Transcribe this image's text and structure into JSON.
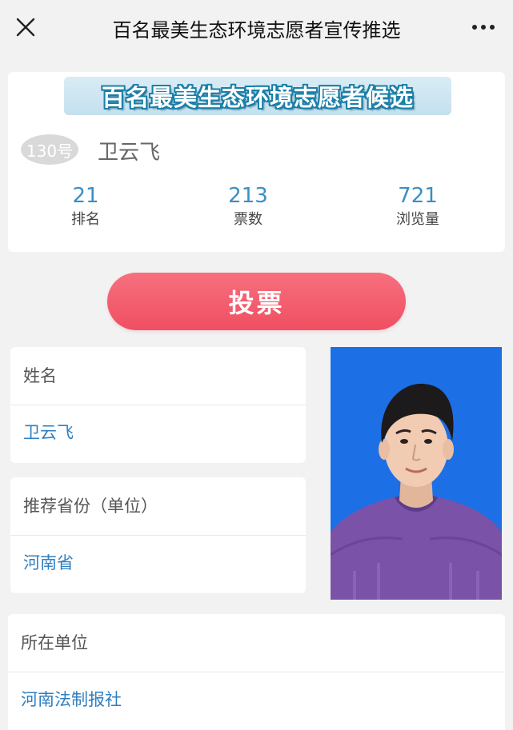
{
  "nav": {
    "title": "百名最美生态环境志愿者宣传推选"
  },
  "banner": {
    "title": "百名最美生态环境志愿者候选"
  },
  "candidate": {
    "number": "130号",
    "name": "卫云飞"
  },
  "stats": [
    {
      "value": "21",
      "label": "排名"
    },
    {
      "value": "213",
      "label": "票数"
    },
    {
      "value": "721",
      "label": "浏览量"
    }
  ],
  "vote_button": "投票",
  "fields": {
    "name": {
      "label": "姓名",
      "value": "卫云飞"
    },
    "province": {
      "label": "推荐省份（单位）",
      "value": "河南省"
    },
    "unit": {
      "label": "所在单位",
      "value": "河南法制报社"
    }
  },
  "colors": {
    "accent_blue": "#3a8fc4",
    "vote_red": "#ef4f61",
    "photo_bg": "#1d6fe6",
    "sweater_purple": "#7a52a8"
  },
  "icons": {
    "close": "close-icon",
    "more": "more-icon"
  }
}
